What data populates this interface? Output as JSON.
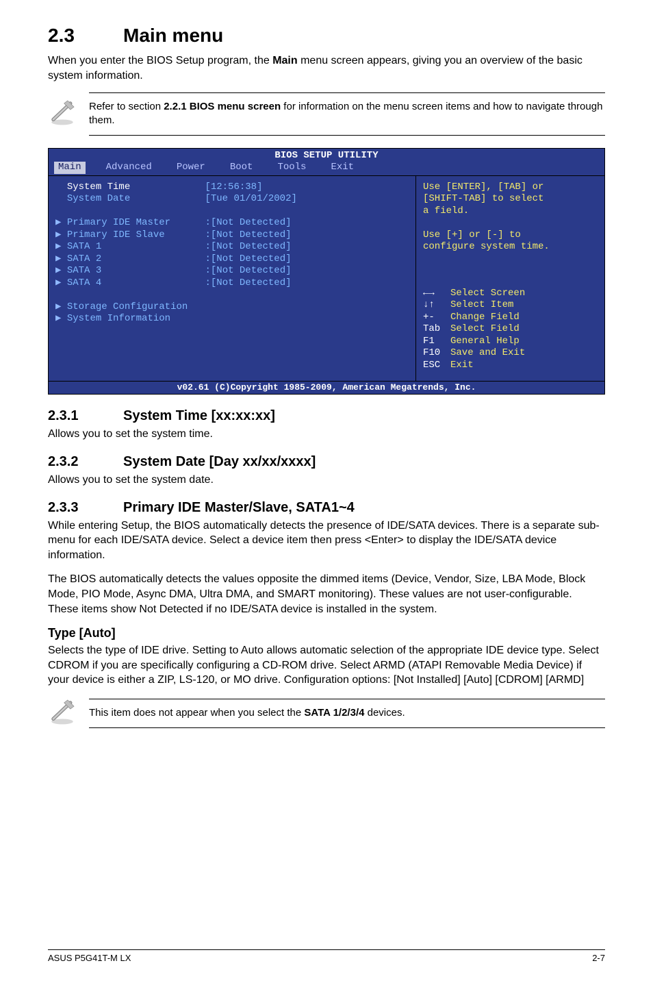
{
  "header": {
    "section_number": "2.3",
    "section_title": "Main menu",
    "intro_pre": "When you enter the BIOS Setup program, the ",
    "intro_bold": "Main",
    "intro_post": " menu screen appears, giving you an overview of the basic system information."
  },
  "note1": {
    "pre": "Refer to section ",
    "bold": "2.2.1 BIOS menu screen",
    "post": " for information on the menu screen items and how to navigate through them."
  },
  "bios": {
    "title": "BIOS SETUP UTILITY",
    "tabs": [
      "Main",
      "Advanced",
      "Power",
      "Boot",
      "Tools",
      "Exit"
    ],
    "selected_tab": "Main",
    "left_rows": [
      {
        "label": "System Time",
        "value": "[12:56:38]",
        "white": true,
        "arrow": false
      },
      {
        "label": "System Date",
        "value": "[Tue 01/01/2002]",
        "white": false,
        "arrow": false
      },
      {
        "blank": true
      },
      {
        "label": "Primary IDE Master",
        "value": ":[Not Detected]",
        "arrow": true
      },
      {
        "label": "Primary IDE Slave",
        "value": ":[Not Detected]",
        "arrow": true
      },
      {
        "label": "SATA 1",
        "value": ":[Not Detected]",
        "arrow": true
      },
      {
        "label": "SATA 2",
        "value": ":[Not Detected]",
        "arrow": true
      },
      {
        "label": "SATA 3",
        "value": ":[Not Detected]",
        "arrow": true
      },
      {
        "label": "SATA 4",
        "value": ":[Not Detected]",
        "arrow": true
      },
      {
        "blank": true
      },
      {
        "label": "Storage Configuration",
        "value": "",
        "arrow": true
      },
      {
        "label": "System Information",
        "value": "",
        "arrow": true
      }
    ],
    "help_lines": [
      "Use [ENTER], [TAB] or",
      "[SHIFT-TAB] to select",
      "a field.",
      "",
      "Use [+] or [-] to",
      "configure system time."
    ],
    "key_help": [
      {
        "sym": "←→",
        "desc": "Select Screen"
      },
      {
        "sym": "↓↑",
        "desc": "Select Item"
      },
      {
        "sym": "+-",
        "desc": "Change Field"
      },
      {
        "sym": "Tab",
        "desc": "Select Field"
      },
      {
        "sym": "F1",
        "desc": "General Help"
      },
      {
        "sym": "F10",
        "desc": "Save and Exit"
      },
      {
        "sym": "ESC",
        "desc": "Exit"
      }
    ],
    "footer": "v02.61 (C)Copyright 1985-2009, American Megatrends, Inc."
  },
  "sections": {
    "s231": {
      "num": "2.3.1",
      "title": "System Time [xx:xx:xx]",
      "body": "Allows you to set the system time."
    },
    "s232": {
      "num": "2.3.2",
      "title": "System Date [Day xx/xx/xxxx]",
      "body": "Allows you to set the system date."
    },
    "s233": {
      "num": "2.3.3",
      "title": "Primary IDE Master/Slave, SATA1~4",
      "p1": "While entering Setup, the BIOS automatically detects the presence of IDE/SATA devices. There is a separate sub-menu for each IDE/SATA device. Select a device item then press <Enter> to display the IDE/SATA device information.",
      "p2": "The BIOS automatically detects the values opposite the dimmed items (Device, Vendor, Size, LBA Mode, Block Mode, PIO Mode, Async DMA, Ultra DMA, and SMART monitoring). These values are not user-configurable. These items show Not Detected if no IDE/SATA device is installed in the system."
    },
    "type_auto": {
      "title": "Type [Auto]",
      "body": "Selects the type of IDE drive. Setting to Auto allows automatic selection of the appropriate IDE device type. Select CDROM if you are specifically configuring a CD-ROM drive. Select ARMD (ATAPI Removable Media Device) if your device is either a ZIP, LS-120, or MO drive. Configuration options: [Not Installed] [Auto] [CDROM] [ARMD]"
    }
  },
  "note2": {
    "pre": "This item does not appear when you select the ",
    "bold": "SATA 1/2/3/4",
    "post": " devices."
  },
  "footer": {
    "left": "ASUS P5G41T-M LX",
    "right": "2-7"
  }
}
